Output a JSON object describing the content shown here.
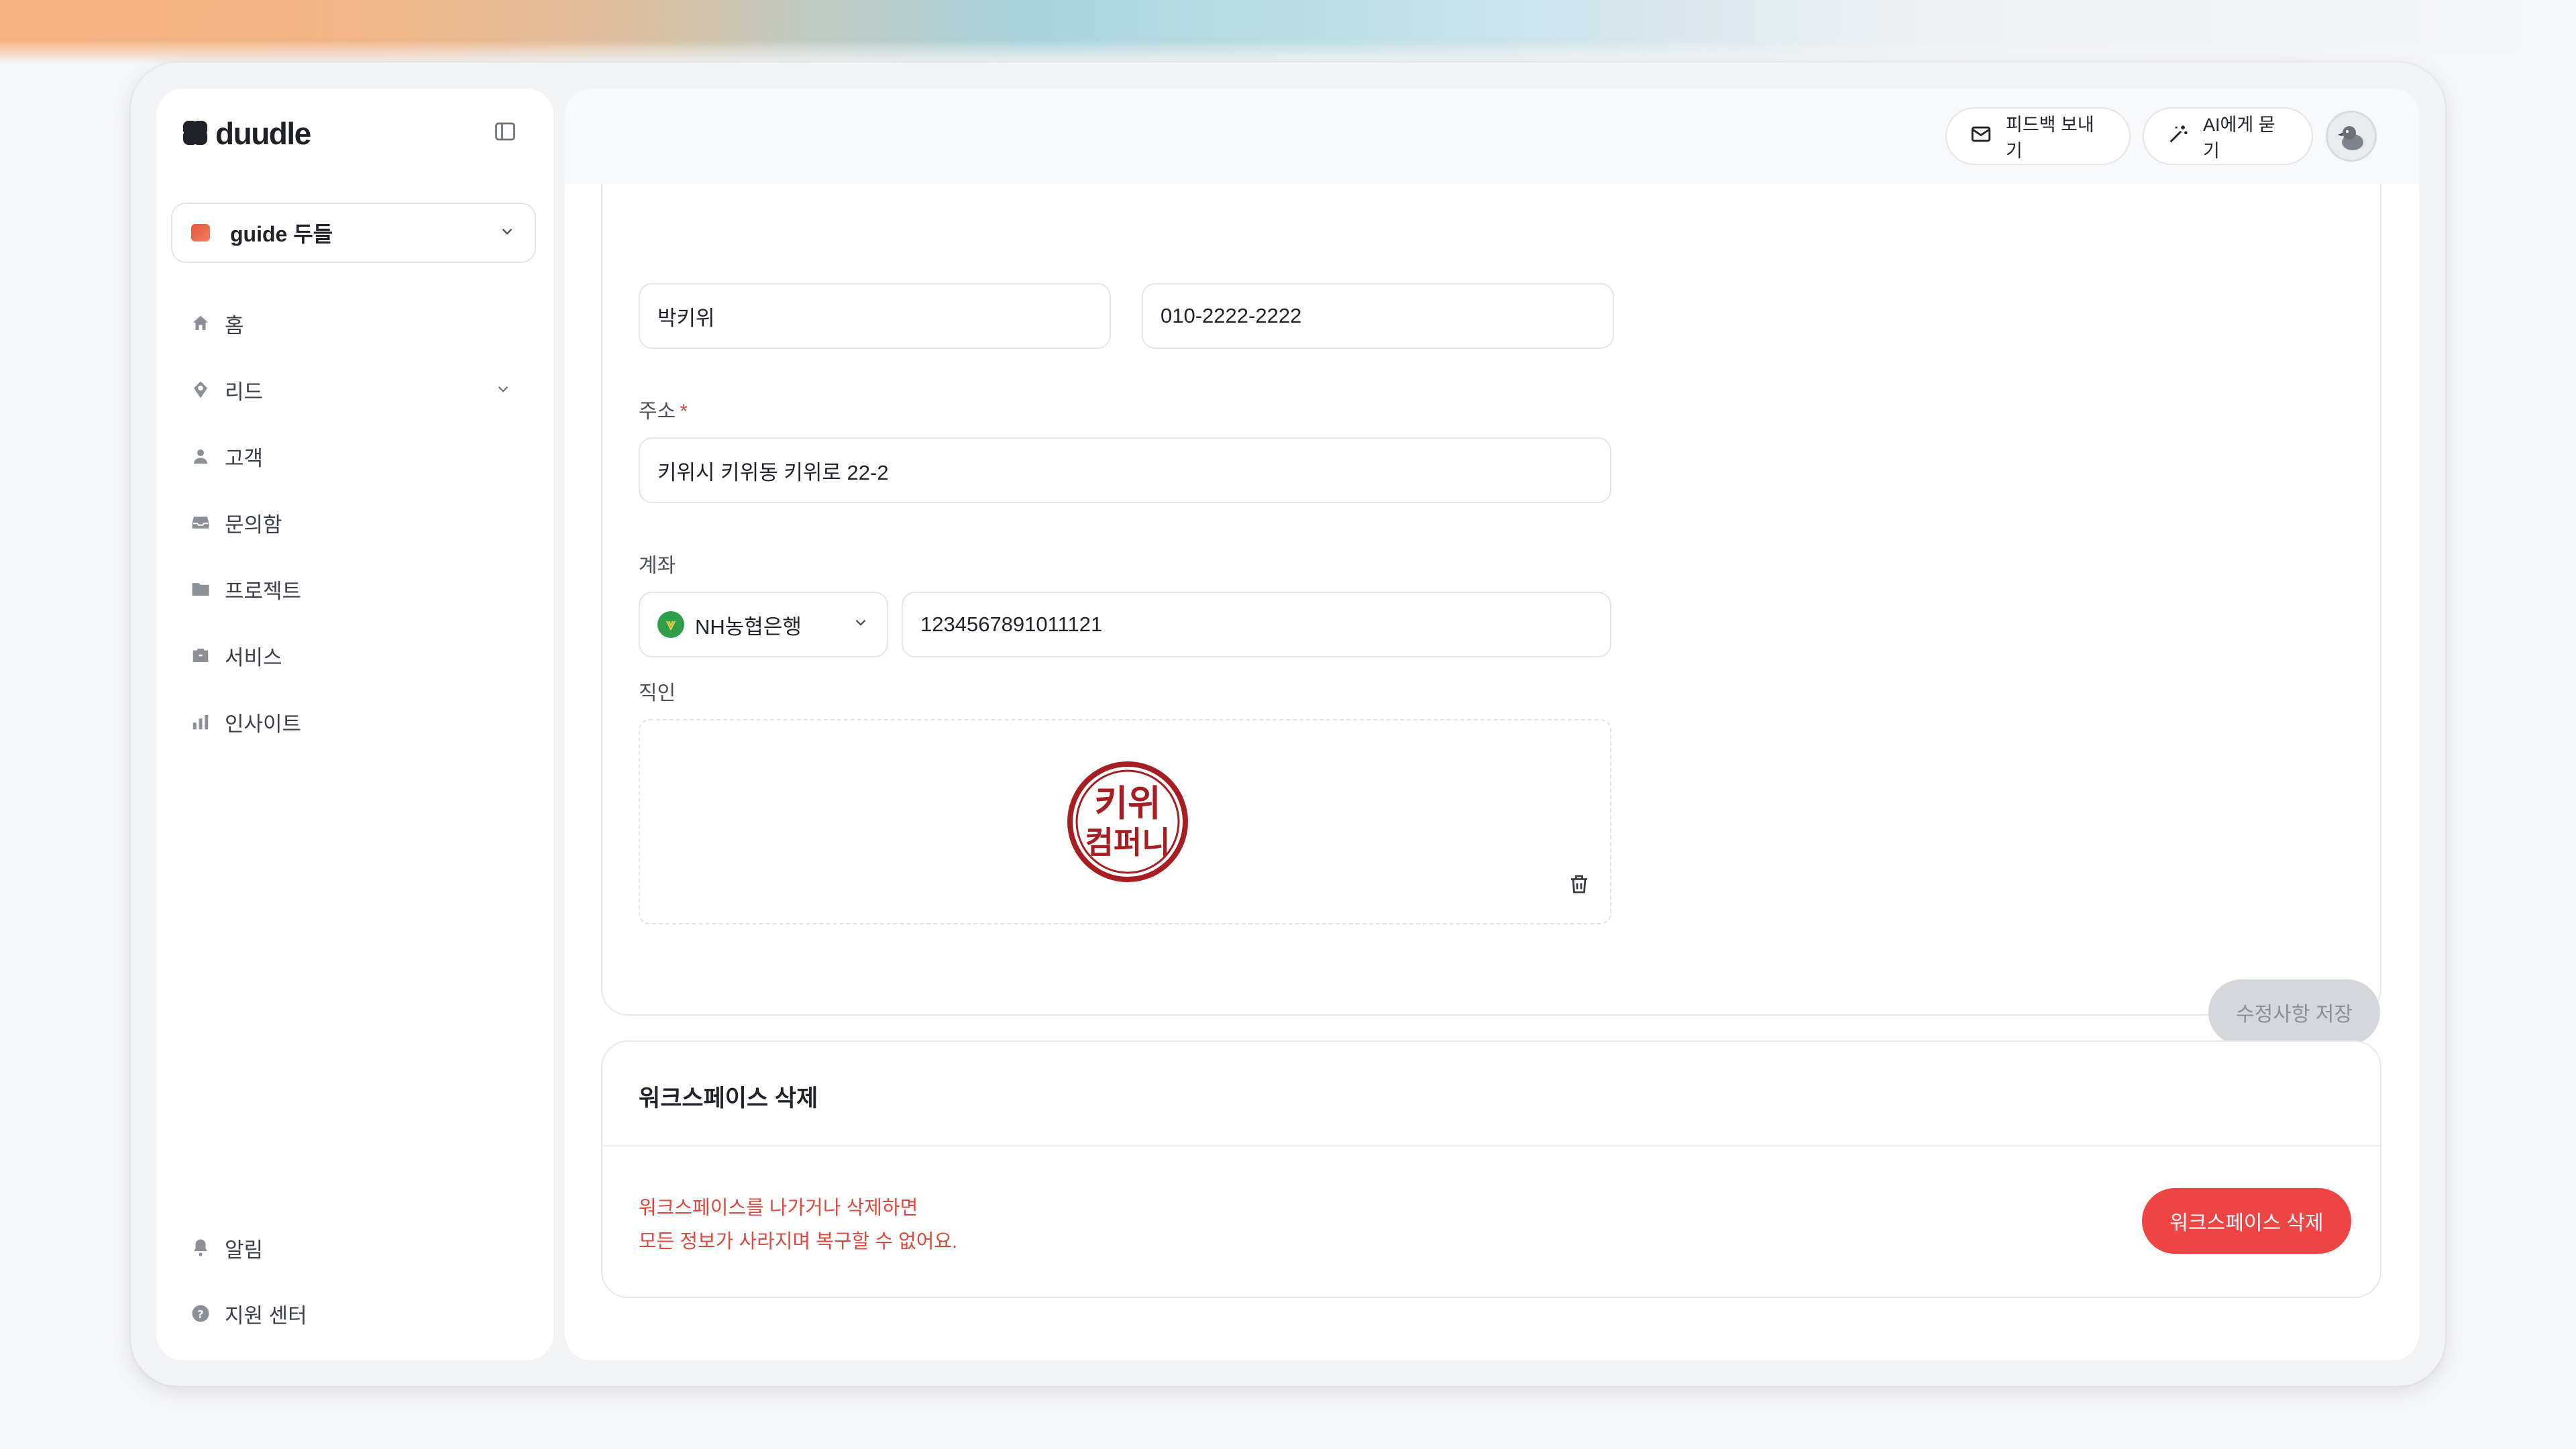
{
  "app": {
    "logo_text": "duudle",
    "workspace": "guide 두들",
    "accent_color": "#ef4444"
  },
  "sidebar": {
    "items": [
      {
        "label": "홈",
        "icon": "home-icon"
      },
      {
        "label": "리드",
        "icon": "lead-icon",
        "expandable": true
      },
      {
        "label": "고객",
        "icon": "person-icon"
      },
      {
        "label": "문의함",
        "icon": "inbox-icon"
      },
      {
        "label": "프로젝트",
        "icon": "folder-icon"
      },
      {
        "label": "서비스",
        "icon": "briefcase-icon"
      },
      {
        "label": "인사이트",
        "icon": "bar-chart-icon"
      }
    ],
    "bottom_items": [
      {
        "label": "알림",
        "icon": "bell-icon"
      },
      {
        "label": "지원 센터",
        "icon": "help-icon"
      }
    ]
  },
  "header": {
    "feedback_label": "피드백 보내기",
    "ask_ai_label": "AI에게 묻기"
  },
  "form": {
    "name_value": "박키위",
    "phone_value": "010-2222-2222",
    "address_label": "주소",
    "address_required_mark": "*",
    "address_value": "키위시 키위동 키위로 22-2",
    "account_label": "계좌",
    "bank_value": "NH농협은행",
    "account_value": "1234567891011121",
    "seal_label": "직인",
    "seal_text_line1": "키위",
    "seal_text_line2": "컴퍼니",
    "save_label": "수정사항 저장"
  },
  "danger_zone": {
    "title": "워크스페이스 삭제",
    "warning_line1": "워크스페이스를 나가거나 삭제하면",
    "warning_line2": "모든 정보가 사라지며 복구할 수 없어요.",
    "delete_label": "워크스페이스 삭제"
  }
}
